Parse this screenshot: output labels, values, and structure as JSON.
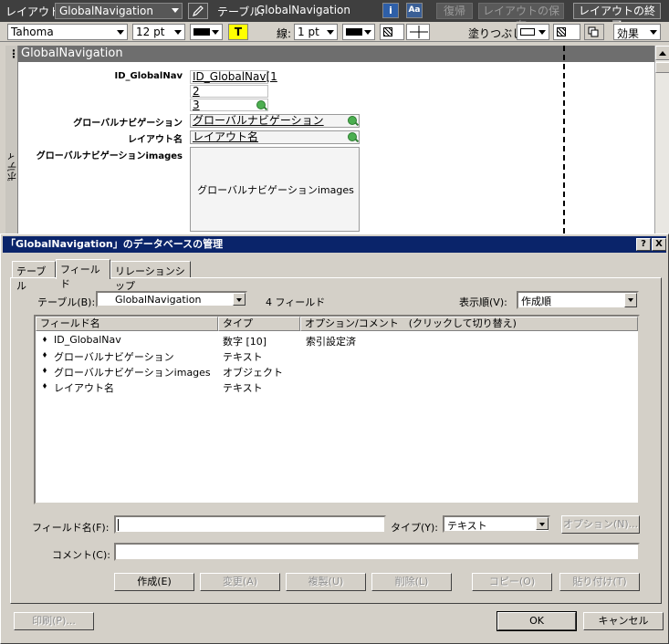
{
  "layout_toolbar": {
    "layout_label": "レイアウト:",
    "layout_value": "GlobalNavigation",
    "table_label": "テーブル:",
    "table_value": "GlobalNavigation",
    "info_icon": "info-icon",
    "font_icon": "text-format-icon",
    "revert_button": "復帰",
    "save_layout_button": "レイアウトの保存",
    "exit_layout_button": "レイアウトの終了"
  },
  "format_toolbar": {
    "font": "Tahoma",
    "size": "12 pt",
    "text_button": "T",
    "line_label": "線:",
    "line_value": "1 pt",
    "fill_label": "塗りつぶし:",
    "effects": "効果"
  },
  "layout": {
    "header": "GlobalNavigation",
    "body_tab": "ボディ",
    "fields": [
      {
        "label": "ID_GlobalNav",
        "value": "ID_GlobalNav[1"
      },
      {
        "label": "グローバルナビゲーション",
        "value": "グローバルナビゲーション"
      },
      {
        "label": "レイアウト名",
        "value": "レイアウト名"
      },
      {
        "label": "グローバルナビゲーションimages",
        "value": "グローバルナビゲーションimages"
      }
    ],
    "portal_rows": [
      "2",
      "3"
    ]
  },
  "dialog": {
    "title": "「GlobalNavigation」のデータベースの管理",
    "help_button": "?",
    "close_button": "X",
    "tabs": [
      "テーブル",
      "フィールド",
      "リレーションシップ"
    ],
    "active_tab": "フィールド",
    "table_label": "テーブル(B):",
    "table_value": "GlobalNavigation",
    "field_count": "4 フィールド",
    "sort_label": "表示順(V):",
    "sort_value": "作成順",
    "columns": [
      "フィールド名",
      "タイプ",
      "オプション/コメント　(クリックして切り替え)"
    ],
    "rows": [
      {
        "name": "ID_GlobalNav",
        "type": "数字 [10]",
        "options": "索引設定済"
      },
      {
        "name": "グローバルナビゲーション",
        "type": "テキスト",
        "options": ""
      },
      {
        "name": "グローバルナビゲーションimages",
        "type": "オブジェクト",
        "options": ""
      },
      {
        "name": "レイアウト名",
        "type": "テキスト",
        "options": ""
      }
    ],
    "field_name_label": "フィールド名(F):",
    "field_name_value": "",
    "type_label": "タイプ(Y):",
    "type_value": "テキスト",
    "options_button": "オプション(N)...",
    "comment_label": "コメント(C):",
    "comment_value": "",
    "buttons": {
      "create": "作成(E)",
      "change": "変更(A)",
      "duplicate": "複製(U)",
      "delete": "削除(L)",
      "copy": "コピー(O)",
      "paste": "貼り付け(T)"
    },
    "print_button": "印刷(P)...",
    "ok_button": "OK",
    "cancel_button": "キャンセル"
  },
  "colors": {
    "titlebar": "#0a246a",
    "toolbar_dark": "#3f3f3f",
    "dialog_face": "#d4d0c8"
  }
}
